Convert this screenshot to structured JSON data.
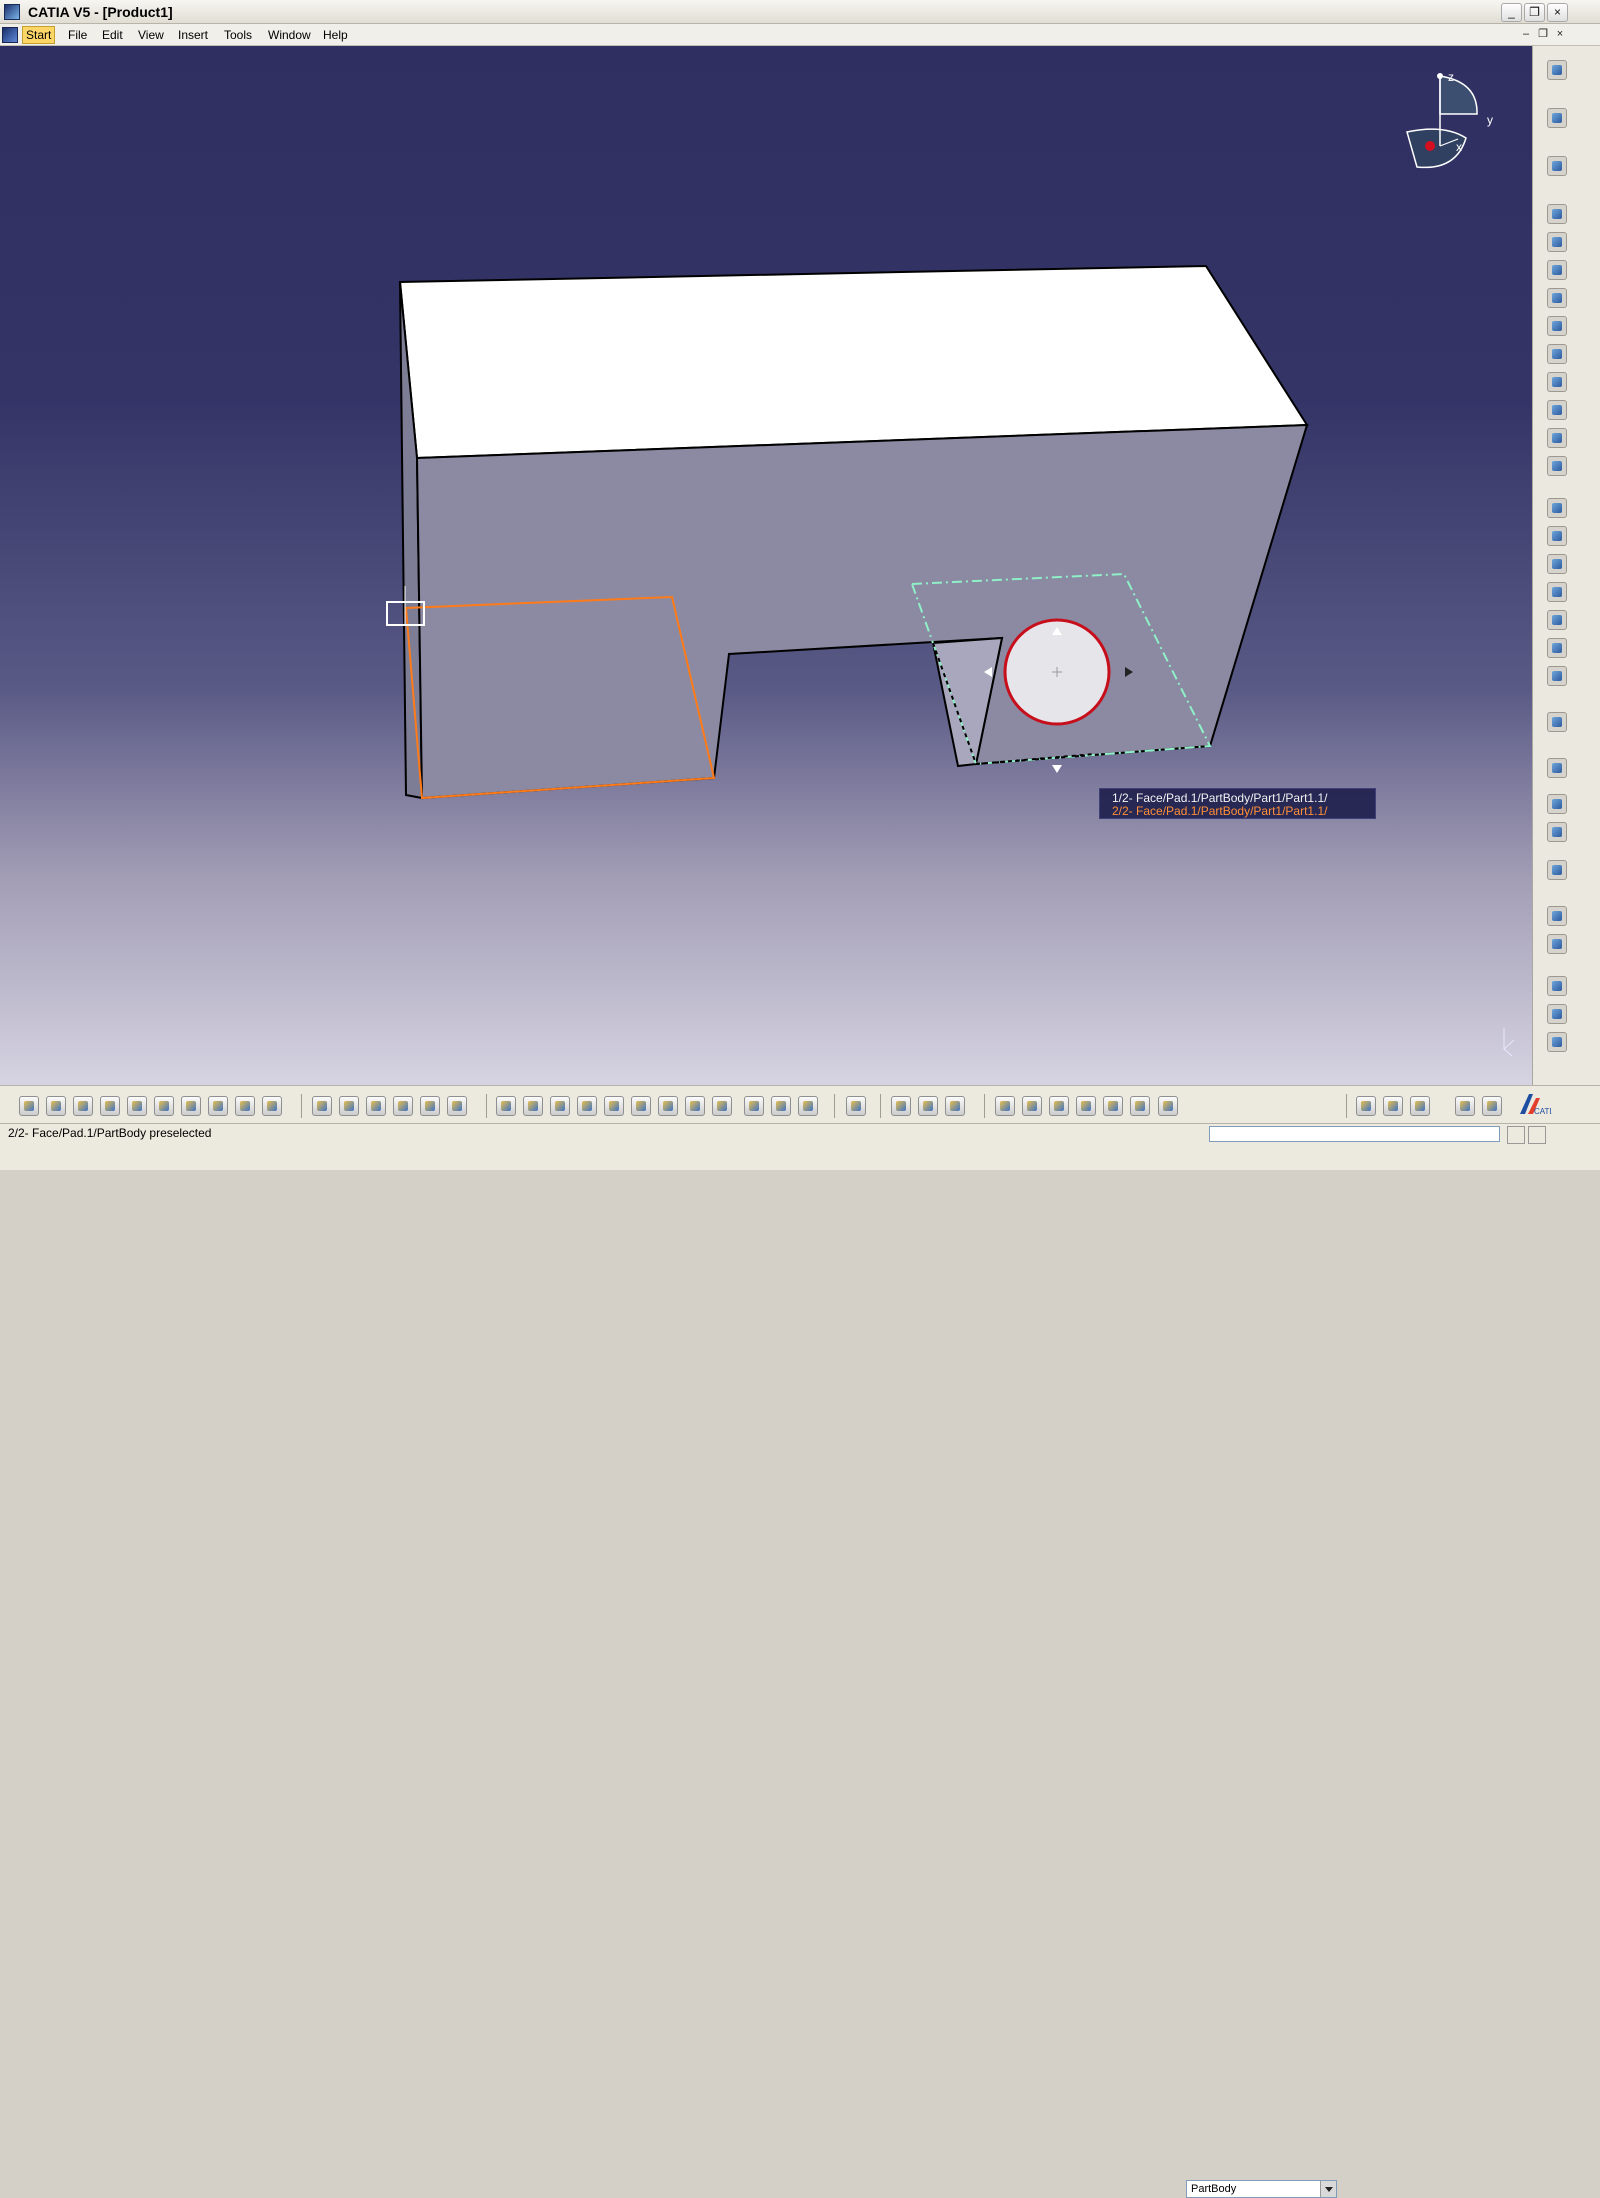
{
  "window": {
    "title": "CATIA V5 - [Product1]",
    "buttons": {
      "minimize": "_",
      "restore": "❐",
      "close": "×"
    }
  },
  "menu": {
    "items": [
      "Start",
      "File",
      "Edit",
      "View",
      "Insert",
      "Tools",
      "Window",
      "Help"
    ],
    "doc_buttons": {
      "minimize": "–",
      "restore": "❐",
      "close": "×"
    }
  },
  "compass": {
    "axis_x": "x",
    "axis_y": "y",
    "axis_z": "z"
  },
  "model_tooltip": {
    "line1": "1/2-  Face/Pad.1/PartBody/Part1/Part1.1/",
    "line2": "2/2-  Face/Pad.1/PartBody/Part1/Part1.1/"
  },
  "toolbar": {
    "active_body": "PartBody",
    "catia_logo": "CATIA"
  },
  "status": {
    "text": "2/2-  Face/Pad.1/PartBody preselected"
  },
  "colors": {
    "viewport_top": "#2f2f61",
    "viewport_mid": "#5a5a86",
    "viewport_bottom": "#d6d3e2",
    "face_light": "#ffffff",
    "face_main": "#8b8aa2",
    "selected_orange": "#ff7a18",
    "guide_green": "#8ff0c8",
    "highlight_red": "#c70f1c"
  }
}
